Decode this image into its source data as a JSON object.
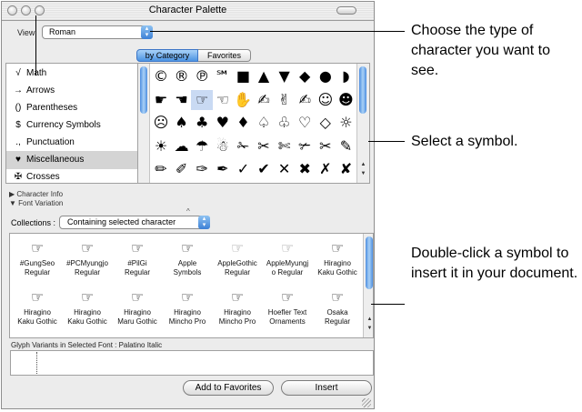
{
  "window": {
    "title": "Character Palette"
  },
  "view": {
    "label": "View",
    "value": "Roman"
  },
  "tabs": [
    {
      "label": "by Category"
    },
    {
      "label": "Favorites"
    }
  ],
  "categories": [
    {
      "icon": "√",
      "label": "Math"
    },
    {
      "icon": "→",
      "label": "Arrows"
    },
    {
      "icon": "()",
      "label": "Parentheses"
    },
    {
      "icon": "$",
      "label": "Currency Symbols"
    },
    {
      "icon": ".,",
      "label": "Punctuation"
    },
    {
      "icon": "♥",
      "label": "Miscellaneous"
    },
    {
      "icon": "✠",
      "label": "Crosses"
    }
  ],
  "symbols": [
    [
      "©",
      "®",
      "℗",
      "℠",
      "■",
      "▲",
      "▼",
      "◆",
      "●",
      "◗"
    ],
    [
      "☛",
      "☚",
      "☞",
      "☜",
      "✋",
      "✍",
      "✌",
      "✍",
      "☺",
      "☻"
    ],
    [
      "☹",
      "♠",
      "♣",
      "♥",
      "♦",
      "♤",
      "♧",
      "♡",
      "◇",
      "☼"
    ],
    [
      "☀",
      "☁",
      "☂",
      "☃",
      "✁",
      "✂",
      "✄",
      "✃",
      "✂",
      "✎"
    ],
    [
      "✏",
      "✐",
      "✑",
      "✒",
      "✓",
      "✔",
      "✕",
      "✖",
      "✗",
      "✘"
    ]
  ],
  "info": {
    "character_info": "Character Info",
    "font_variation": "Font Variation"
  },
  "collections": {
    "label": "Collections :",
    "value": "Containing selected character"
  },
  "fonts": [
    {
      "glyph": "☞",
      "name1": "#GungSeo",
      "name2": "Regular",
      "pale": false
    },
    {
      "glyph": "☞",
      "name1": "#PCMyungjo",
      "name2": "Regular",
      "pale": false
    },
    {
      "glyph": "☞",
      "name1": "#PilGi",
      "name2": "Regular",
      "pale": false
    },
    {
      "glyph": "☞",
      "name1": "Apple",
      "name2": "Symbols",
      "pale": false
    },
    {
      "glyph": "☞",
      "name1": "AppleGothic",
      "name2": "Regular",
      "pale": true
    },
    {
      "glyph": "☞",
      "name1": "AppleMyungj",
      "name2": "o Regular",
      "pale": true
    },
    {
      "glyph": "☞",
      "name1": "Hiragino",
      "name2": "Kaku Gothic",
      "pale": false
    },
    {
      "glyph": "☞",
      "name1": "Hiragino",
      "name2": "Kaku Gothic",
      "pale": false
    },
    {
      "glyph": "☞",
      "name1": "Hiragino",
      "name2": "Kaku Gothic",
      "pale": false
    },
    {
      "glyph": "☞",
      "name1": "Hiragino",
      "name2": "Maru Gothic",
      "pale": false
    },
    {
      "glyph": "☞",
      "name1": "Hiragino",
      "name2": "Mincho Pro",
      "pale": false
    },
    {
      "glyph": "☞",
      "name1": "Hiragino",
      "name2": "Mincho Pro",
      "pale": false
    },
    {
      "glyph": "☞",
      "name1": "Hoefler Text",
      "name2": "Ornaments",
      "pale": false
    },
    {
      "glyph": "☞",
      "name1": "Osaka",
      "name2": "Regular",
      "pale": false
    }
  ],
  "glyph_variants": {
    "label": "Glyph Variants in Selected Font : Palatino Italic"
  },
  "buttons": {
    "add_favorites": "Add to Favorites",
    "insert": "Insert"
  },
  "callouts": [
    {
      "text": "Choose the type of character you want to see."
    },
    {
      "text": "Select a symbol."
    },
    {
      "text": "Double-click a symbol to insert it in your document."
    }
  ]
}
